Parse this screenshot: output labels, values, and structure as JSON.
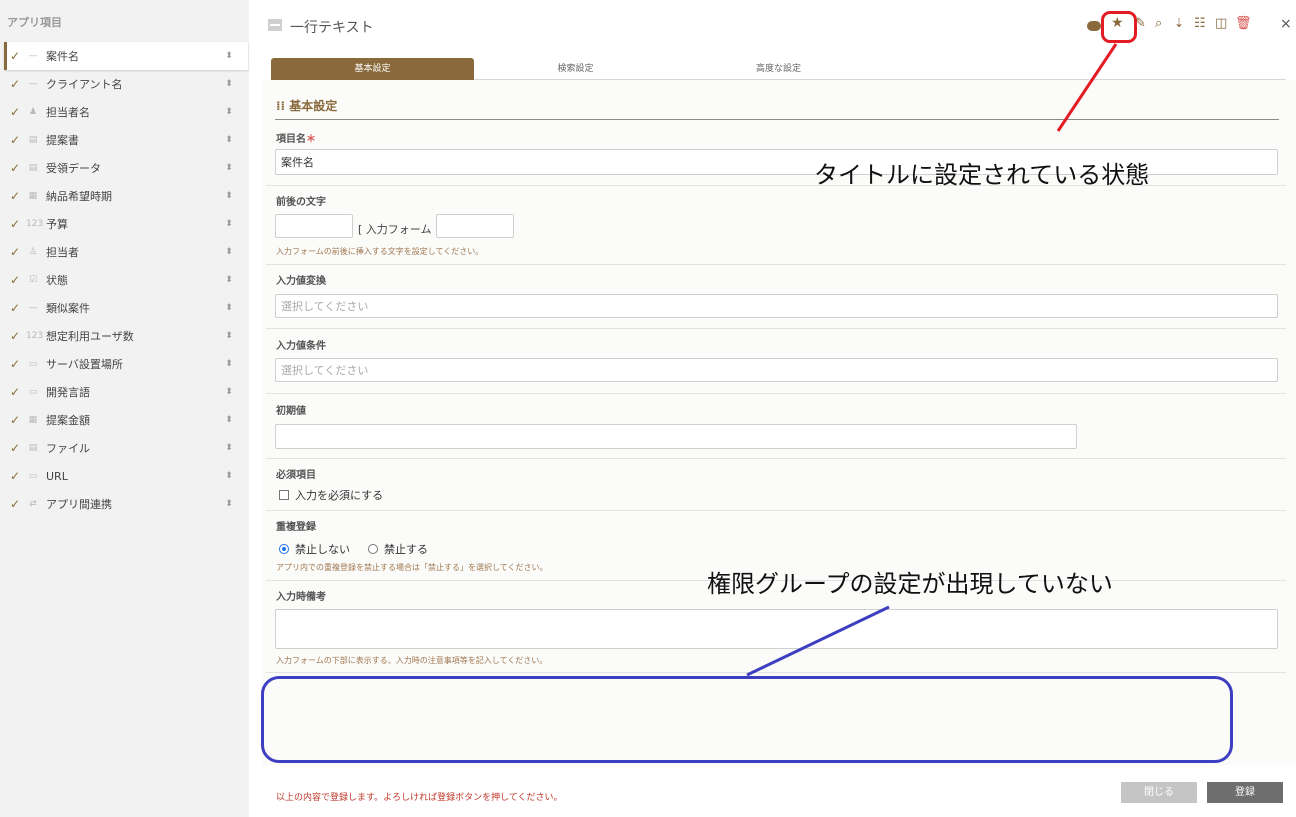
{
  "sidebar": {
    "title": "アプリ項目",
    "items": [
      {
        "label": "案件名",
        "icon": "—",
        "active": true
      },
      {
        "label": "クライアント名",
        "icon": "—"
      },
      {
        "label": "担当者名",
        "icon": "♟"
      },
      {
        "label": "提案書",
        "icon": "▤"
      },
      {
        "label": "受領データ",
        "icon": "▤"
      },
      {
        "label": "納品希望時期",
        "icon": "▦"
      },
      {
        "label": "予算",
        "icon": "123"
      },
      {
        "label": "担当者",
        "icon": "♙"
      },
      {
        "label": "状態",
        "icon": "☑"
      },
      {
        "label": "類似案件",
        "icon": "—"
      },
      {
        "label": "想定利用ユーザ数",
        "icon": "123"
      },
      {
        "label": "サーバ設置場所",
        "icon": "▭"
      },
      {
        "label": "開発言語",
        "icon": "▭"
      },
      {
        "label": "提案金額",
        "icon": "▦"
      },
      {
        "label": "ファイル",
        "icon": "▤"
      },
      {
        "label": "URL",
        "icon": "▭"
      },
      {
        "label": "アプリ間連携",
        "icon": "⇄"
      }
    ]
  },
  "header": {
    "title": "一行テキスト",
    "toolbar": {
      "star": "★",
      "pen": "✎",
      "search": "⌕",
      "sort": "⇣",
      "list": "☷",
      "columns": "◫",
      "trash": "🗑",
      "close": "×"
    }
  },
  "tabs": [
    "基本設定",
    "検索設定",
    "高度な設定"
  ],
  "form": {
    "section_title": "⁞⁞ 基本設定",
    "item_name_label": "項目名",
    "required_mark": "＊",
    "item_name_value": "案件名",
    "prefix_suffix_label": "前後の文字",
    "input_form_text": "[ 入力フォーム ]",
    "prefix_suffix_hint": "入力フォームの前後に挿入する文字を設定してください。",
    "conversion_label": "入力値変換",
    "conversion_placeholder": "選択してください",
    "condition_label": "入力値条件",
    "condition_placeholder": "選択してください",
    "initial_label": "初期値",
    "required_label": "必須項目",
    "required_checkbox": "入力を必須にする",
    "duplicate_label": "重複登録",
    "duplicate_options": [
      "禁止しない",
      "禁止する"
    ],
    "duplicate_hint": "アプリ内での重複登録を禁止する場合は「禁止する」を選択してください。",
    "note_label": "入力時備考",
    "note_hint": "入力フォームの下部に表示する、入力時の注意事項等を記入してください。"
  },
  "annotations": {
    "title_state": "タイトルに設定されている状態",
    "no_permission_group": "権限グループの設定が出現していない"
  },
  "footer": {
    "message": "以上の内容で登録します。よろしければ登録ボタンを押してください。",
    "close_button": "閉じる",
    "save_button": "登録"
  },
  "colors": {
    "accent": "#8a6a3c",
    "annotation_red": "#e31b23",
    "annotation_blue": "#3d3fc0"
  }
}
